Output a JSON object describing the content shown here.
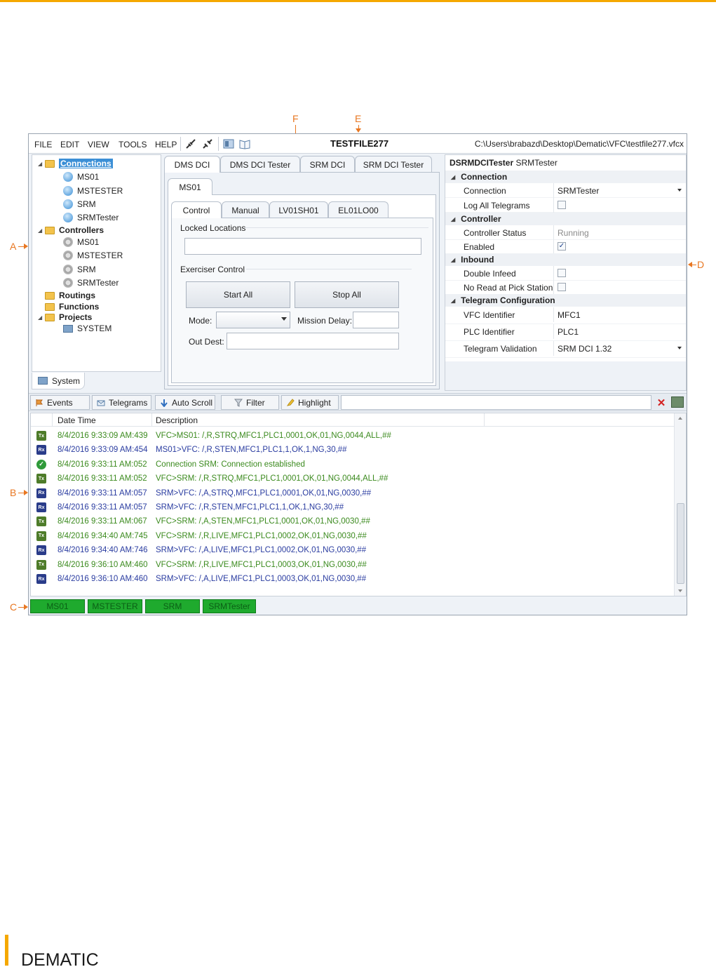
{
  "callouts": {
    "a": "A",
    "b": "B",
    "c": "C",
    "d": "D",
    "e": "E",
    "f": "F"
  },
  "menu": [
    "FILE",
    "EDIT",
    "VIEW",
    "TOOLS",
    "HELP"
  ],
  "window": {
    "title": "TESTFILE277",
    "path": "C:\\Users\\brabazd\\Desktop\\Dematic\\VFC\\testfile277.vfcx"
  },
  "tree": {
    "connections": "Connections",
    "connection_items": [
      "MS01",
      "MSTESTER",
      "SRM",
      "SRMTester"
    ],
    "controllers": "Controllers",
    "controller_items": [
      "MS01",
      "MSTESTER",
      "SRM",
      "SRMTester"
    ],
    "routings": "Routings",
    "functions": "Functions",
    "projects": "Projects",
    "project_items": [
      "SYSTEM"
    ],
    "bottom_tab": "System"
  },
  "tabs": {
    "top": [
      "DMS DCI",
      "DMS DCI  Tester",
      "SRM DCI",
      "SRM DCI Tester"
    ],
    "sub": "MS01",
    "inner": [
      "Control",
      "Manual",
      "LV01SH01",
      "EL01LO00"
    ]
  },
  "control": {
    "locked_label": "Locked Locations",
    "exerciser_label": "Exerciser Control",
    "start_all": "Start All",
    "stop_all": "Stop All",
    "mode_label": "Mode:",
    "mission_delay_label": "Mission Delay:",
    "out_dest_label": "Out Dest:"
  },
  "props": {
    "header_bold": "DSRMDCITester",
    "header_name": "SRMTester",
    "cat_connection": "Connection",
    "connection_label": "Connection",
    "connection_value": "SRMTester",
    "log_all_label": "Log All Telegrams",
    "log_all_checked": false,
    "cat_controller": "Controller",
    "controller_status_label": "Controller Status",
    "controller_status_value": "Running",
    "enabled_label": "Enabled",
    "enabled_checked": true,
    "cat_inbound": "Inbound",
    "double_infeed_label": "Double Infeed",
    "no_read_label": "No Read at Pick Station",
    "cat_telegram": "Telegram Configuration",
    "vfc_id_label": "VFC Identifier",
    "vfc_id_value": "MFC1",
    "plc_id_label": "PLC Identifier",
    "plc_id_value": "PLC1",
    "validation_label": "Telegram Validation",
    "validation_value": "SRM DCI 1.32"
  },
  "logbar": {
    "events": "Events",
    "telegrams": "Telegrams",
    "auto_scroll": "Auto Scroll",
    "filter": "Filter",
    "highlight": "Highlight"
  },
  "log": {
    "col_datetime": "Date Time",
    "col_description": "Description",
    "rows": [
      {
        "kind": "tx",
        "badge": "Tx",
        "time": "8/4/2016 9:33:09 AM:439",
        "desc": "VFC>MS01: /,R,STRQ,MFC1,PLC1,0001,OK,01,NG,0044,ALL,##"
      },
      {
        "kind": "rx",
        "badge": "Rx",
        "time": "8/4/2016 9:33:09 AM:454",
        "desc": "MS01>VFC: /,R,STEN,MFC1,PLC1,1,OK,1,NG,30,##"
      },
      {
        "kind": "ok",
        "badge": "✓",
        "time": "8/4/2016 9:33:11 AM:052",
        "desc": "Connection SRM: Connection established"
      },
      {
        "kind": "tx",
        "badge": "Tx",
        "time": "8/4/2016 9:33:11 AM:052",
        "desc": "VFC>SRM: /,R,STRQ,MFC1,PLC1,0001,OK,01,NG,0044,ALL,##"
      },
      {
        "kind": "rx",
        "badge": "Rx",
        "time": "8/4/2016 9:33:11 AM:057",
        "desc": "SRM>VFC: /,A,STRQ,MFC1,PLC1,0001,OK,01,NG,0030,##"
      },
      {
        "kind": "rx",
        "badge": "Rx",
        "time": "8/4/2016 9:33:11 AM:057",
        "desc": "SRM>VFC: /,R,STEN,MFC1,PLC1,1,OK,1,NG,30,##"
      },
      {
        "kind": "tx",
        "badge": "Tx",
        "time": "8/4/2016 9:33:11 AM:067",
        "desc": "VFC>SRM: /,A,STEN,MFC1,PLC1,0001,OK,01,NG,0030,##"
      },
      {
        "kind": "tx",
        "badge": "Tx",
        "time": "8/4/2016 9:34:40 AM:745",
        "desc": "VFC>SRM: /,R,LIVE,MFC1,PLC1,0002,OK,01,NG,0030,##"
      },
      {
        "kind": "rx",
        "badge": "Rx",
        "time": "8/4/2016 9:34:40 AM:746",
        "desc": "SRM>VFC: /,A,LIVE,MFC1,PLC1,0002,OK,01,NG,0030,##"
      },
      {
        "kind": "tx",
        "badge": "Tx",
        "time": "8/4/2016 9:36:10 AM:460",
        "desc": "VFC>SRM: /,R,LIVE,MFC1,PLC1,0003,OK,01,NG,0030,##"
      },
      {
        "kind": "rx",
        "badge": "Rx",
        "time": "8/4/2016 9:36:10 AM:460",
        "desc": "SRM>VFC: /,A,LIVE,MFC1,PLC1,0003,OK,01,NG,0030,##"
      }
    ]
  },
  "status_chips": [
    "MS01",
    "MSTESTER",
    "SRM",
    "SRMTester"
  ],
  "colors": {
    "accent": "#f5a800",
    "callout": "#e87722",
    "tx": "#3b8a1e",
    "rx": "#2a3ca0",
    "status_ok": "#1faa2e"
  },
  "footer": {
    "brand": "DEMATIC"
  }
}
